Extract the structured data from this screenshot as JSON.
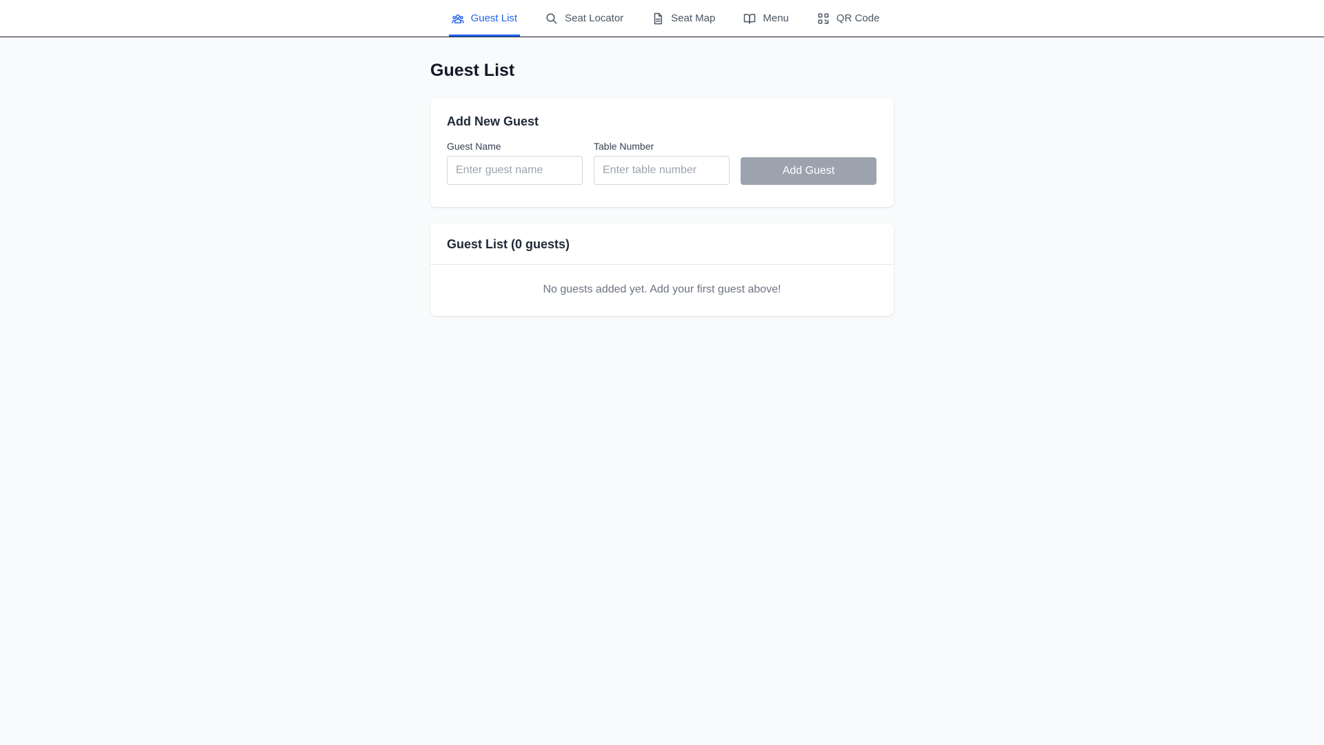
{
  "nav": {
    "tabs": [
      {
        "label": "Guest List",
        "icon": "users-icon",
        "active": true
      },
      {
        "label": "Seat Locator",
        "icon": "search-icon",
        "active": false
      },
      {
        "label": "Seat Map",
        "icon": "document-icon",
        "active": false
      },
      {
        "label": "Menu",
        "icon": "book-icon",
        "active": false
      },
      {
        "label": "QR Code",
        "icon": "qr-code-icon",
        "active": false
      }
    ],
    "active_color": "#2563eb",
    "inactive_color": "#4b5563"
  },
  "page": {
    "title": "Guest List"
  },
  "add_guest": {
    "title": "Add New Guest",
    "name_label": "Guest Name",
    "name_value": "",
    "name_placeholder": "Enter guest name",
    "table_label": "Table Number",
    "table_value": "",
    "table_placeholder": "Enter table number",
    "button_label": "Add Guest",
    "button_color": "#9ca3af"
  },
  "guest_list": {
    "title": "Guest List (0 guests)",
    "empty_message": "No guests added yet. Add your first guest above!",
    "guests": []
  }
}
